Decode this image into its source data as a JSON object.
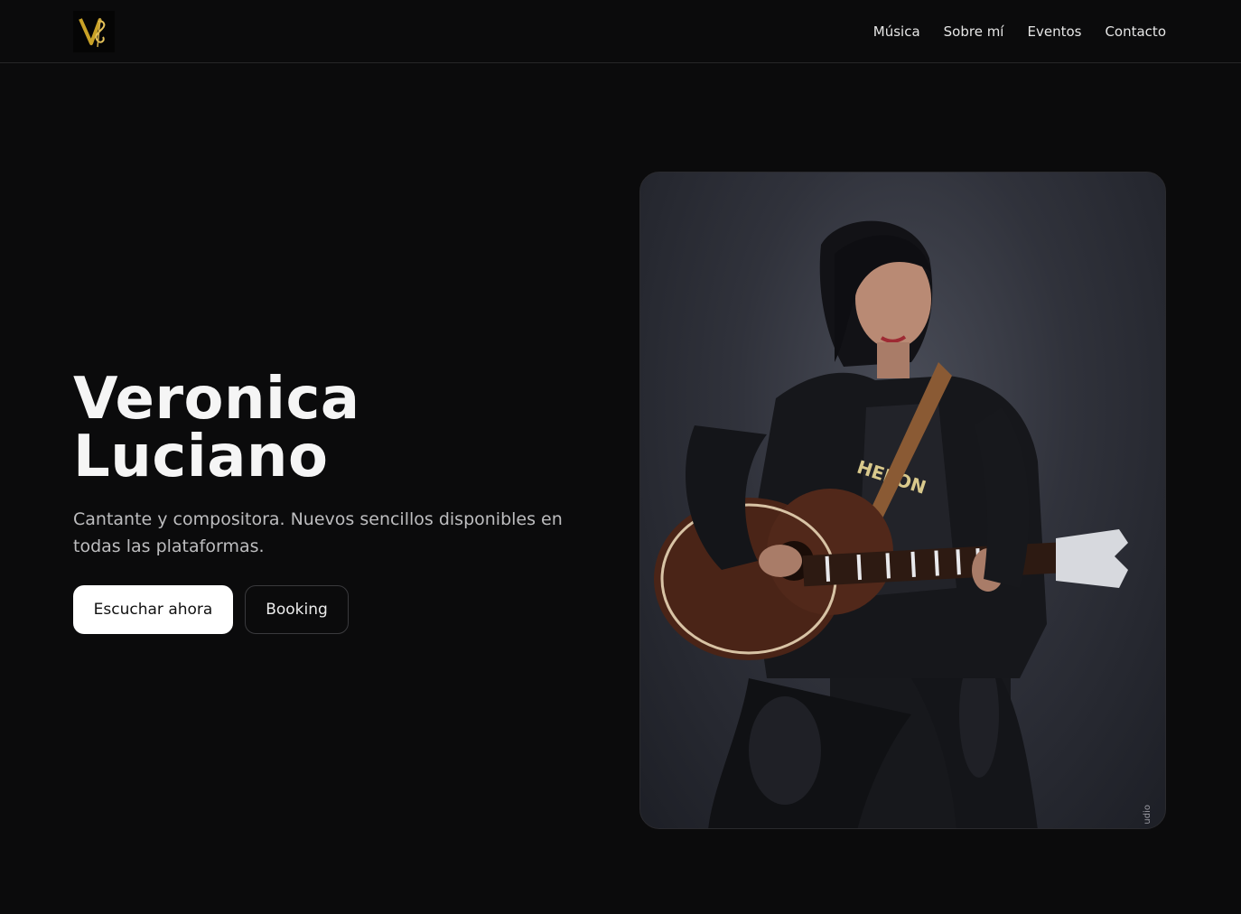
{
  "nav": {
    "logo_alt": "VL",
    "links": [
      "Música",
      "Sobre mí",
      "Eventos",
      "Contacto"
    ]
  },
  "hero": {
    "title_line1": "Veronica",
    "title_line2": "Luciano",
    "subtitle": "Cantante y compositora. Nuevos sencillos disponibles en todas las plataformas.",
    "primary_cta": "Escuchar ahora",
    "secondary_cta": "Booking"
  },
  "photo": {
    "credit": "udio"
  },
  "colors": {
    "background": "#0b0b0c",
    "accent_gold": "#c9a227",
    "primary_button": "#ffffff"
  }
}
